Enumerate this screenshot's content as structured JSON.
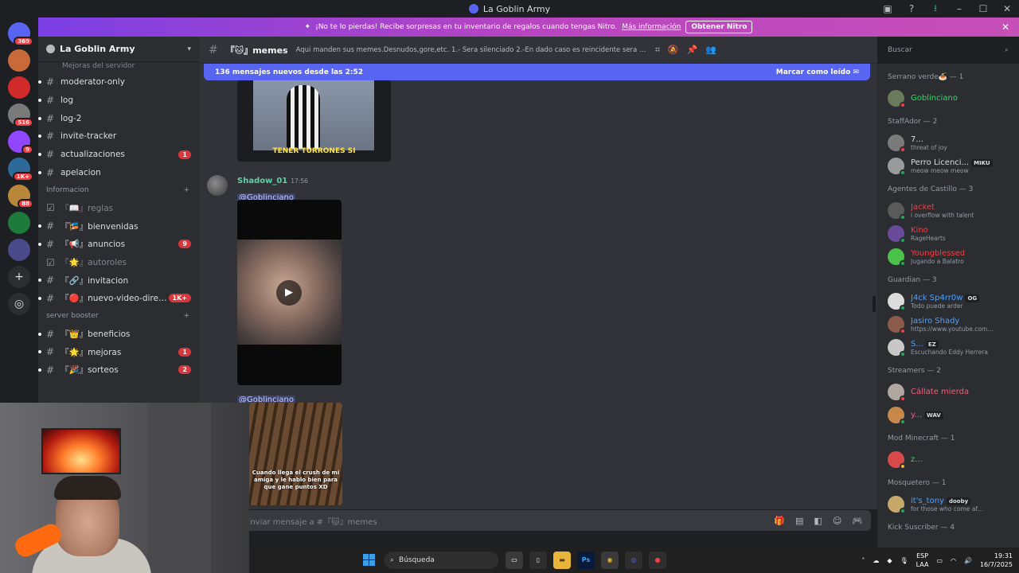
{
  "window": {
    "title": "La Goblin Army"
  },
  "servers": [
    {
      "name": "discord-home",
      "badge": "369",
      "color": "#5865f2"
    },
    {
      "name": "server-1",
      "badge": "",
      "color": "#c86a3a"
    },
    {
      "name": "server-2",
      "badge": "",
      "color": "#d02a2a"
    },
    {
      "name": "server-3",
      "badge": "516",
      "color": "#7a7a7a"
    },
    {
      "name": "server-4",
      "badge": "9",
      "color": "#9146ff"
    },
    {
      "name": "server-5",
      "badge": "1K+",
      "color": "#2d6a9a"
    },
    {
      "name": "server-6",
      "badge": "88",
      "color": "#b8873a"
    },
    {
      "name": "server-7",
      "badge": "",
      "color": "#1d7a3a"
    },
    {
      "name": "server-8",
      "badge": "",
      "color": "#4a4a8a"
    }
  ],
  "nitro_banner": {
    "text": "¡No te lo pierdas! Recibe sorpresas en tu inventario de regalos cuando tengas Nitro.",
    "link": "Más información",
    "button": "Obtener Nitro"
  },
  "guild": {
    "name": "La Goblin Army",
    "partial_text": "Mejoras del servidor"
  },
  "channels_top": [
    {
      "name": "moderator-only",
      "unread": true,
      "count": ""
    },
    {
      "name": "log",
      "unread": true,
      "count": ""
    },
    {
      "name": "log-2",
      "unread": true,
      "count": ""
    },
    {
      "name": "invite-tracker",
      "unread": true,
      "count": ""
    },
    {
      "name": "actualizaciones",
      "unread": true,
      "count": "1"
    },
    {
      "name": "apelacion",
      "unread": true,
      "count": ""
    }
  ],
  "category_info": "Informacion",
  "channels_info": [
    {
      "name": "『📖』reglas",
      "muted": true,
      "count": "",
      "unread": false
    },
    {
      "name": "『🎏』bienvenidas",
      "muted": false,
      "count": "",
      "unread": true
    },
    {
      "name": "『📢』anuncios",
      "muted": false,
      "count": "9",
      "unread": true
    },
    {
      "name": "『🌟』autoroles",
      "muted": true,
      "count": "",
      "unread": false
    },
    {
      "name": "『🔗』invitacion",
      "muted": false,
      "count": "",
      "unread": true
    },
    {
      "name": "『🔴』nuevo-video-direc...",
      "muted": false,
      "count": "1K+",
      "unread": true
    }
  ],
  "category_booster": "server booster",
  "channels_booster": [
    {
      "name": "『👑』beneficios",
      "count": "",
      "unread": true
    },
    {
      "name": "『🌟』mejoras",
      "count": "1",
      "unread": true
    },
    {
      "name": "『🎉』sorteos",
      "count": "2",
      "unread": true
    }
  ],
  "channel_header": {
    "name": "『🐱』memes",
    "topic": "Aqui manden sus memes.Desnudos,gore,etc. 1.- Sera silenciado 2.-En dado caso es reincidente sera baneado",
    "search_placeholder": "Buscar"
  },
  "new_messages": {
    "text": "136 mensajes nuevos desde las 2:52",
    "mark_read": "Marcar como leído"
  },
  "messages": {
    "image_caption": "TENER TURRONES  SI",
    "author": "Shadow_01",
    "time": "17:56",
    "mention1": "@Goblinciano",
    "mention2": "@Goblinciano",
    "video2_caption": "Cuando llega el crush de mi amiga y le hablo bien para que gane puntos XD"
  },
  "composer": {
    "placeholder": "Enviar mensaje a #『🐱』memes"
  },
  "members": [
    {
      "role": "Serrano verde🍝 — 1",
      "items": [
        {
          "name": "Goblinciano",
          "status": "",
          "color": "#23e25d",
          "avatar": "#6a7a5a",
          "presence": "#f23f43",
          "tag": ""
        }
      ]
    },
    {
      "role": "StaffAdor — 2",
      "items": [
        {
          "name": "7...",
          "status": "threat of joy",
          "color": "#dbdee1",
          "avatar": "#7a7a7a",
          "presence": "#f23f43",
          "tag": ""
        },
        {
          "name": "Perro Licenci...",
          "status": "meow meow meow",
          "color": "#dbdee1",
          "avatar": "#9a9a9a",
          "presence": "#23a55a",
          "tag": "MIKU"
        }
      ]
    },
    {
      "role": "Agentes de Castillo — 3",
      "items": [
        {
          "name": "Jacket",
          "status": "i overflow with talent",
          "color": "#f23f43",
          "avatar": "#5a5a5a",
          "presence": "#23a55a",
          "tag": ""
        },
        {
          "name": "Kino",
          "status": "RageHearts",
          "color": "#f23f43",
          "avatar": "#6a4a9a",
          "presence": "#23a55a",
          "tag": ""
        },
        {
          "name": "Youngblessed",
          "status": "Jugando a Balatro",
          "color": "#f23f43",
          "avatar": "#4ac24a",
          "presence": "#23a55a",
          "tag": ""
        }
      ]
    },
    {
      "role": "Guardian — 3",
      "items": [
        {
          "name": "J4ck Sp4rr0w",
          "status": "Todo puede arder",
          "color": "#4aa3ff",
          "avatar": "#dcdcdc",
          "presence": "#23a55a",
          "tag": "OG"
        },
        {
          "name": "Jasiro Shady",
          "status": "https://www.youtube.com...",
          "color": "#4aa3ff",
          "avatar": "#8a5a4a",
          "presence": "#f23f43",
          "tag": ""
        },
        {
          "name": "S...",
          "status": "Escuchando Eddy Herrera",
          "color": "#4aa3ff",
          "avatar": "#c8c8c8",
          "presence": "#23a55a",
          "tag": "EZ"
        }
      ]
    },
    {
      "role": "Streamers — 2",
      "items": [
        {
          "name": "Cállate mierda",
          "status": "",
          "color": "#f2607a",
          "avatar": "#b0a8a0",
          "presence": "#f23f43",
          "tag": ""
        },
        {
          "name": "y...",
          "status": "",
          "color": "#f2607a",
          "avatar": "#c8884a",
          "presence": "#23a55a",
          "tag": "WAV"
        }
      ]
    },
    {
      "role": "Mod Minecraft — 1",
      "items": [
        {
          "name": "z...",
          "status": "",
          "color": "#23e25d",
          "avatar": "#d84a4a",
          "presence": "#f0b232",
          "tag": ""
        }
      ]
    },
    {
      "role": "Mosquetero — 1",
      "items": [
        {
          "name": "it's_tony",
          "status": "for those who come af...",
          "color": "#4aa3ff",
          "avatar": "#c8a86a",
          "presence": "#23a55a",
          "tag": "dooby"
        }
      ]
    },
    {
      "role": "Kick Suscriber — 4",
      "items": []
    }
  ],
  "taskbar": {
    "search": "Búsqueda",
    "lang_top": "ESP",
    "lang_bottom": "LAA",
    "time": "19:31",
    "date": "16/7/2025"
  }
}
